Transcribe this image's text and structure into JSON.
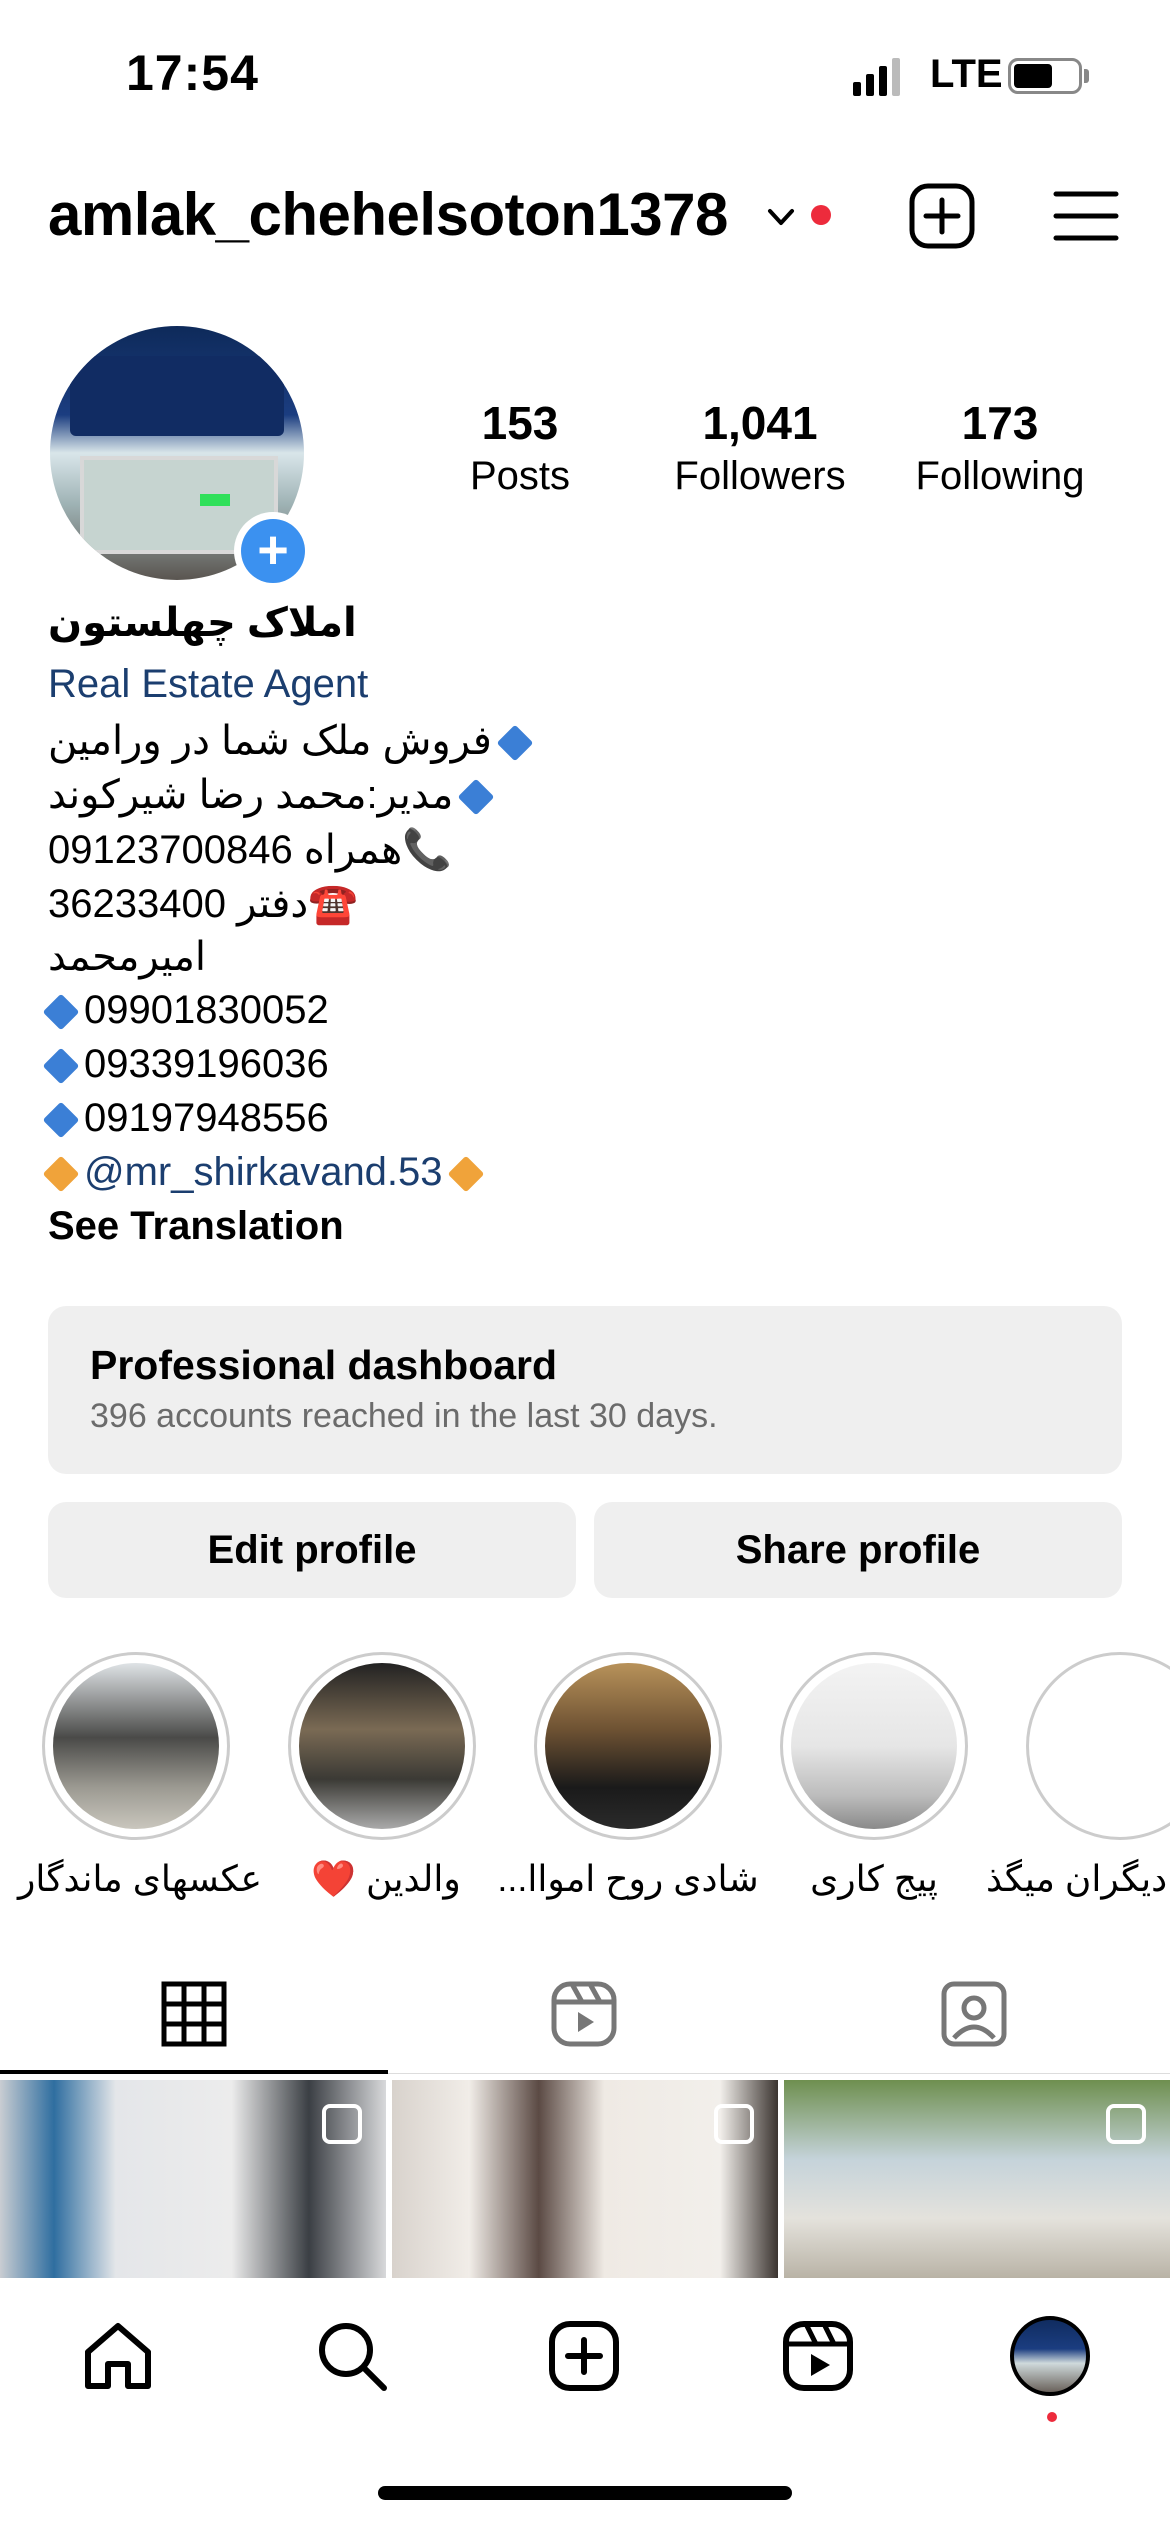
{
  "status_bar": {
    "time": "17:54",
    "network": "LTE",
    "battery_level": 0.55
  },
  "header": {
    "username": "amlak_chehelsoton1378"
  },
  "stats": [
    {
      "number": "153",
      "label": "Posts"
    },
    {
      "number": "1,041",
      "label": "Followers"
    },
    {
      "number": "173",
      "label": "Following"
    }
  ],
  "bio": {
    "name": "املاک چهلستون",
    "category": "Real Estate Agent",
    "lines": [
      "فروش ملک شما در ورامین",
      "مدیر:محمد رضا شیرکوند",
      "09123700846 همراه📞",
      "36233400 دفتر☎️",
      "امیرمحمد",
      "09901830052",
      "09339196036",
      "09197948556"
    ],
    "mention": "@mr_shirkavand.53",
    "see_translation": "See Translation"
  },
  "dashboard": {
    "title": "Professional dashboard",
    "subtitle": "396 accounts reached in the last 30 days."
  },
  "buttons": {
    "edit": "Edit profile",
    "share": "Share profile"
  },
  "highlights": [
    {
      "label": "عکسهای ماندگار"
    },
    {
      "label": "والدین ❤️"
    },
    {
      "label": "شادی روح امواا..."
    },
    {
      "label": "پیج کاری"
    },
    {
      "label": "دیگران میگذ..."
    }
  ],
  "tabs": [
    "grid-icon",
    "reels-icon",
    "tagged-icon"
  ],
  "nav": [
    "home-icon",
    "search-icon",
    "create-icon",
    "reels-icon",
    "profile-avatar"
  ]
}
